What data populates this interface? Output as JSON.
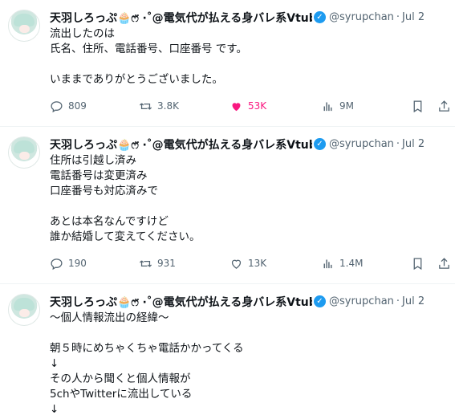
{
  "author": {
    "name": "天羽しろっぷ🧁ෆ̈ ‧˚@電気代が払える身バレ系Vtuber",
    "handle": "@syrupchan",
    "date": "Jul 2"
  },
  "tweets": [
    {
      "lines": [
        "流出したのは",
        "氏名、住所、電話番号、口座番号 です。",
        "",
        "いままでありがとうございました。"
      ],
      "replies": "809",
      "retweets": "3.8K",
      "likes": "53K",
      "views": "9M",
      "liked": true
    },
    {
      "lines": [
        "住所は引越し済み",
        "電話番号は変更済み",
        "口座番号も対応済みで",
        "",
        "あとは本名なんですけど",
        "誰か結婚して変えてください。"
      ],
      "replies": "190",
      "retweets": "931",
      "likes": "13K",
      "views": "1.4M",
      "liked": false
    },
    {
      "lines": [
        "～個人情報流出の経緯～",
        "",
        "朝５時にめちゃくちゃ電話かかってくる",
        "↓",
        "その人から聞くと個人情報が",
        "5chやTwitterに流出している",
        "↓"
      ]
    }
  ],
  "colors": {
    "text": "#0f1419",
    "muted": "#536471",
    "like": "#f91880",
    "verified": "#1d9bf0"
  }
}
